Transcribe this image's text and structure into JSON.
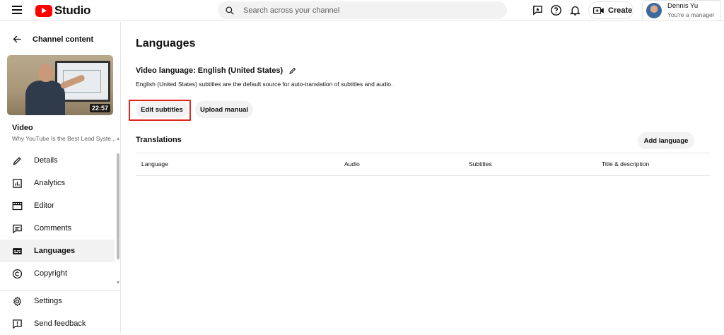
{
  "topbar": {
    "logo_text": "Studio",
    "search_placeholder": "Search across your channel",
    "create_label": "Create",
    "account_name": "Dennis Yu",
    "account_role": "You're a manager"
  },
  "sidebar": {
    "back_label": "Channel content",
    "thumbnail_duration": "22:57",
    "video_label": "Video",
    "video_title": "Why YouTube Is the Best Lead Syste...",
    "items": [
      {
        "label": "Details",
        "icon": "pencil-icon"
      },
      {
        "label": "Analytics",
        "icon": "analytics-icon"
      },
      {
        "label": "Editor",
        "icon": "editor-icon"
      },
      {
        "label": "Comments",
        "icon": "comments-icon"
      },
      {
        "label": "Languages",
        "icon": "subtitles-icon",
        "active": true
      },
      {
        "label": "Copyright",
        "icon": "copyright-icon"
      }
    ],
    "bottom_items": [
      {
        "label": "Settings",
        "icon": "gear-icon"
      },
      {
        "label": "Send feedback",
        "icon": "feedback-icon"
      }
    ]
  },
  "main": {
    "title": "Languages",
    "video_language": "Video language: English (United States)",
    "video_language_desc": "English (United States) subtitles are the default source for auto-translation of subtitles and audio.",
    "edit_subtitles_label": "Edit subtitles",
    "upload_manual_label": "Upload manual",
    "translations_label": "Translations",
    "add_language_label": "Add language",
    "columns": [
      "Language",
      "Audio",
      "Subtitles",
      "Title & description"
    ]
  },
  "colors": {
    "brand_red": "#ff0000",
    "highlight_red": "#e1261c",
    "button_bg": "#f2f2f2"
  }
}
